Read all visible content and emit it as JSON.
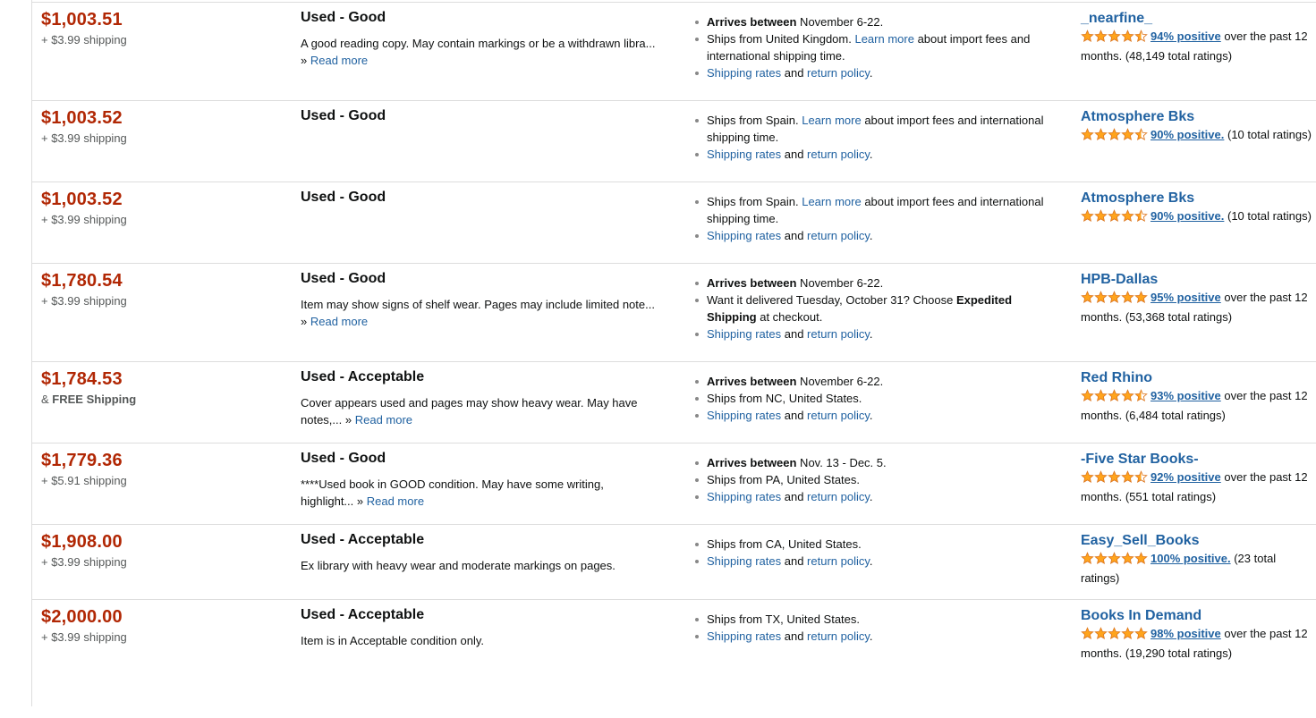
{
  "offers": [
    {
      "price": "$1,003.51",
      "shipping": "+ $3.99 shipping",
      "condition": "Used - Good",
      "description": "A good reading copy. May contain markings or be a withdrawn libra...",
      "read_more": "Read more",
      "delivery": [
        {
          "bold": "Arrives between",
          "text": " November 6-22."
        },
        {
          "text": "Ships from United Kingdom. ",
          "link": "Learn more",
          "after": " about import fees and international shipping time."
        },
        {
          "link": "Shipping rates",
          "text": " and ",
          "link2": "return policy",
          "after": "."
        }
      ],
      "seller": "_nearfine_",
      "rating": 4.5,
      "positive": "94% positive",
      "rating_text": " over the past 12 months. (48,149 total ratings)"
    },
    {
      "price": "$1,003.52",
      "shipping": "+ $3.99 shipping",
      "condition": "Used - Good",
      "description": "",
      "read_more": "",
      "delivery": [
        {
          "text": "Ships from Spain. ",
          "link": "Learn more",
          "after": " about import fees and international shipping time."
        },
        {
          "link": "Shipping rates",
          "text": " and ",
          "link2": "return policy",
          "after": "."
        }
      ],
      "seller": "Atmosphere Bks",
      "rating": 4.5,
      "positive": "90% positive.",
      "rating_text": " (10 total ratings)"
    },
    {
      "price": "$1,003.52",
      "shipping": "+ $3.99 shipping",
      "condition": "Used - Good",
      "description": "",
      "read_more": "",
      "delivery": [
        {
          "text": "Ships from Spain. ",
          "link": "Learn more",
          "after": " about import fees and international shipping time."
        },
        {
          "link": "Shipping rates",
          "text": " and ",
          "link2": "return policy",
          "after": "."
        }
      ],
      "seller": "Atmosphere Bks",
      "rating": 4.5,
      "positive": "90% positive.",
      "rating_text": " (10 total ratings)"
    },
    {
      "price": "$1,780.54",
      "shipping": "+ $3.99 shipping",
      "condition": "Used - Good",
      "description": "Item may show signs of shelf wear. Pages may include limited note...",
      "read_more": "Read more",
      "delivery": [
        {
          "bold": "Arrives between",
          "text": " November 6-22."
        },
        {
          "text": "Want it delivered Tuesday, October 31? Choose ",
          "bold2": "Expedited Shipping",
          "after": " at checkout."
        },
        {
          "link": "Shipping rates",
          "text": " and ",
          "link2": "return policy",
          "after": "."
        }
      ],
      "seller": "HPB-Dallas",
      "rating": 5,
      "positive": "95% positive",
      "rating_text": " over the past 12 months. (53,368 total ratings)"
    },
    {
      "price": "$1,784.53",
      "shipping_prefix": "& ",
      "shipping_bold": "FREE Shipping",
      "shipping": "",
      "condition": "Used - Acceptable",
      "description": "Cover appears used and pages may show heavy wear. May have notes,...",
      "read_more": "Read more",
      "delivery": [
        {
          "bold": "Arrives between",
          "text": " November 6-22."
        },
        {
          "text": "Ships from NC, United States."
        },
        {
          "link": "Shipping rates",
          "text": " and ",
          "link2": "return policy",
          "after": "."
        }
      ],
      "seller": "Red Rhino",
      "rating": 4.5,
      "positive": "93% positive",
      "rating_text": " over the past 12 months. (6,484 total ratings)"
    },
    {
      "price": "$1,779.36",
      "shipping": "+ $5.91 shipping",
      "condition": "Used - Good",
      "description": "****Used book in GOOD condition. May have some writing, highlight...",
      "read_more": "Read more",
      "delivery": [
        {
          "bold": "Arrives between",
          "text": " Nov. 13 - Dec. 5."
        },
        {
          "text": "Ships from PA, United States."
        },
        {
          "link": "Shipping rates",
          "text": " and ",
          "link2": "return policy",
          "after": "."
        }
      ],
      "seller": "-Five Star Books-",
      "rating": 4.5,
      "positive": "92% positive",
      "rating_text": " over the past 12 months. (551 total ratings)"
    },
    {
      "price": "$1,908.00",
      "shipping": "+ $3.99 shipping",
      "condition": "Used - Acceptable",
      "description": "Ex library with heavy wear and moderate markings on pages.",
      "read_more": "",
      "delivery": [
        {
          "text": "Ships from CA, United States."
        },
        {
          "link": "Shipping rates",
          "text": " and ",
          "link2": "return policy",
          "after": "."
        }
      ],
      "seller": "Easy_Sell_Books",
      "rating": 5,
      "positive": "100% positive.",
      "rating_text": " (23 total ratings)"
    },
    {
      "price": "$2,000.00",
      "shipping": "+ $3.99 shipping",
      "condition": "Used - Acceptable",
      "description": "Item is in Acceptable condition only.",
      "read_more": "",
      "delivery": [
        {
          "text": "Ships from TX, United States."
        },
        {
          "link": "Shipping rates",
          "text": " and ",
          "link2": "return policy",
          "after": "."
        }
      ],
      "seller": "Books In Demand",
      "rating": 5,
      "positive": "98% positive",
      "rating_text": " over the past 12 months. (19,290 total ratings)"
    }
  ],
  "colors": {
    "price": "#B12704",
    "link": "#2162a1",
    "star": "#FFA41C"
  },
  "icons": {
    "rating": "star-icon"
  }
}
